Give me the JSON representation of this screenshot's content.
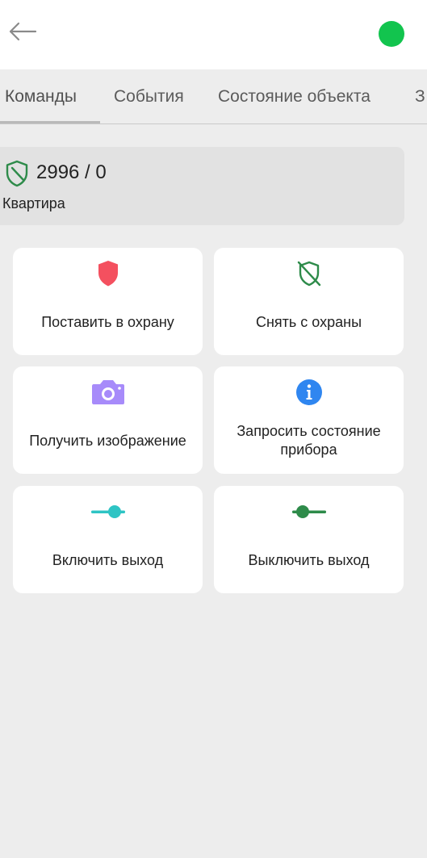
{
  "header": {
    "back_icon": "arrow-left-icon",
    "status_color": "#12c44e"
  },
  "tabs": [
    {
      "label": "Команды",
      "active": true
    },
    {
      "label": "События",
      "active": false
    },
    {
      "label": "Состояние объекта",
      "active": false
    },
    {
      "label": "З",
      "active": false
    }
  ],
  "object": {
    "icon": "shield-off-icon",
    "count": "2996 / 0",
    "name": "Квартира"
  },
  "commands": [
    {
      "label": "Поставить в охрану",
      "icon": "shield-icon",
      "color": "#f4505f"
    },
    {
      "label": "Снять с охраны",
      "icon": "shield-off-icon",
      "color": "#2e8b4a"
    },
    {
      "label": "Получить изображение",
      "icon": "camera-icon",
      "color": "#a78bfa"
    },
    {
      "label": "Запросить состояние прибора",
      "icon": "info-icon",
      "color": "#2f86f0"
    },
    {
      "label": "Включить выход",
      "icon": "toggle-on-icon",
      "color": "#2ec4c4"
    },
    {
      "label": "Выключить выход",
      "icon": "toggle-off-icon",
      "color": "#2e8b4a"
    }
  ]
}
